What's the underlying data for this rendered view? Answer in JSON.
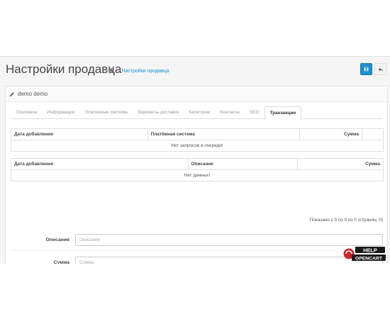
{
  "header": {
    "title": "Настройки продавца",
    "breadcrumb": {
      "separator": "›",
      "current": "Настройки продавца"
    }
  },
  "panel": {
    "title": "demo demo"
  },
  "tabs": [
    {
      "label": "Основное",
      "active": false
    },
    {
      "label": "Информация",
      "active": false
    },
    {
      "label": "Платежные системы",
      "active": false
    },
    {
      "label": "Варианты доставок",
      "active": false
    },
    {
      "label": "Категории",
      "active": false
    },
    {
      "label": "Контакты",
      "active": false
    },
    {
      "label": "SEO",
      "active": false
    },
    {
      "label": "Транзакции",
      "active": true
    }
  ],
  "queue_table": {
    "columns": [
      "Дата добавления",
      "Платёжная система",
      "Сумма",
      ""
    ],
    "empty_message": "Нет запросов в очереди!"
  },
  "transactions_table": {
    "columns": [
      "Дата добавления",
      "Описание",
      "Сумма"
    ],
    "empty_message": "Нет данных!"
  },
  "pagination": {
    "text": "Показано с 0 по 0 из 0 (страниц: 0)"
  },
  "form": {
    "description": {
      "label": "Описания",
      "placeholder": "Описания",
      "value": ""
    },
    "amount": {
      "label": "Сумма",
      "placeholder": "Сумма",
      "value": ""
    }
  },
  "watermark": {
    "line1": "HELP",
    "line2": "OPENCART"
  },
  "colors": {
    "primary": "#1e91cf",
    "background": "#f5f5f5",
    "border": "#e0e0e0"
  },
  "icons": {
    "breadcrumb_home": "home-icon",
    "save_button": "save-icon",
    "back_button": "reply-icon",
    "panel_heading": "pencil-icon"
  }
}
